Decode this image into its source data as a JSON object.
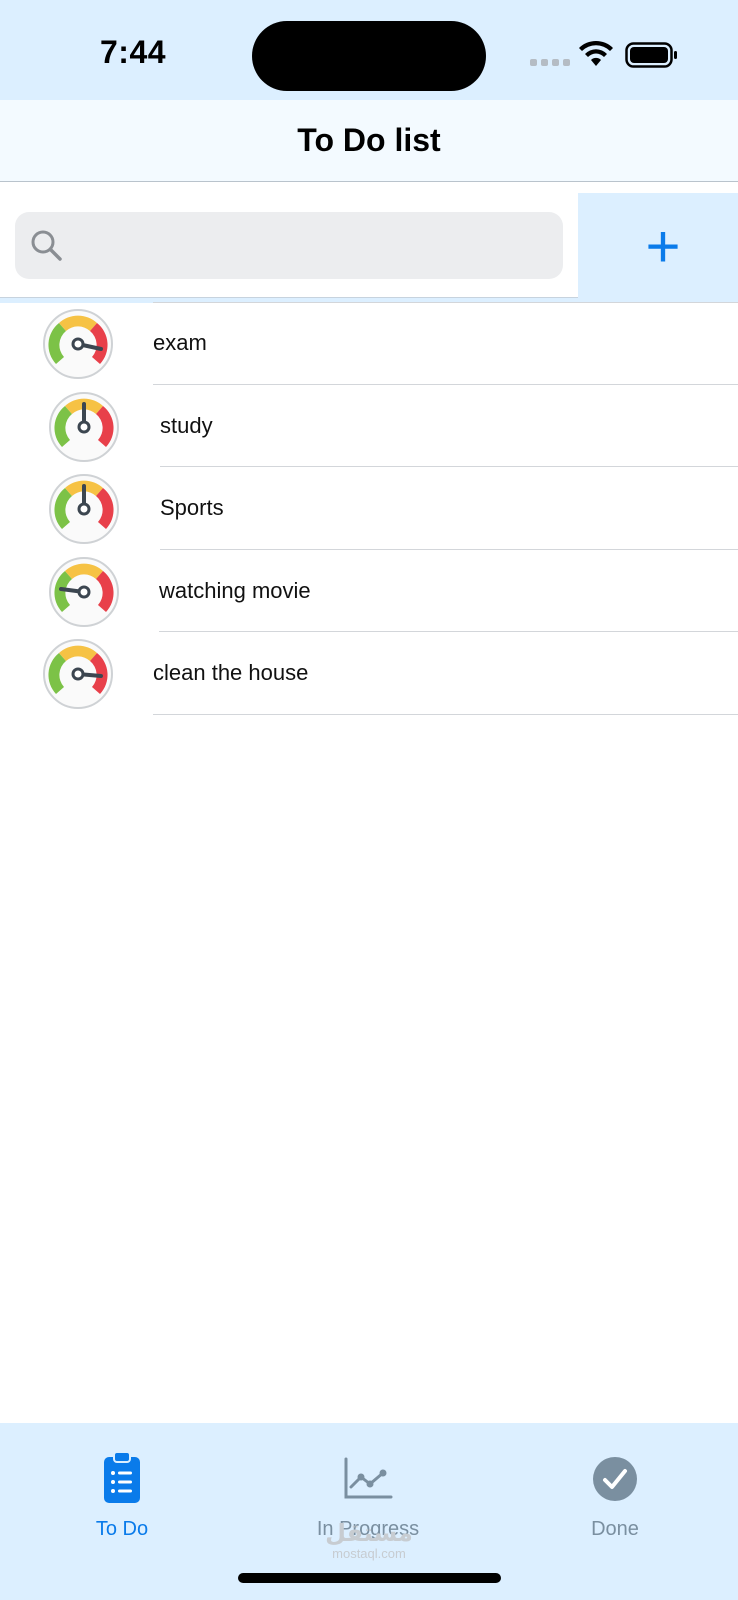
{
  "status": {
    "time": "7:44"
  },
  "nav": {
    "title": "To Do list"
  },
  "search": {
    "placeholder": "",
    "value": "",
    "add_label": "+"
  },
  "tasks": [
    {
      "label": "exam",
      "priority": "high"
    },
    {
      "label": "study",
      "priority": "medium"
    },
    {
      "label": "Sports",
      "priority": "medium"
    },
    {
      "label": "watching movie",
      "priority": "low"
    },
    {
      "label": "clean the house",
      "priority": "high"
    }
  ],
  "tabs": [
    {
      "label": "To Do",
      "icon": "clipboard-list-icon",
      "active": true
    },
    {
      "label": "In Progress",
      "icon": "line-chart-icon",
      "active": false
    },
    {
      "label": "Done",
      "icon": "checkmark-circle-icon",
      "active": false
    }
  ],
  "watermark": {
    "arabic": "مستقل",
    "latin": "mostaql.com"
  },
  "colors": {
    "accent": "#0a7bea",
    "bar_background": "#dcefff",
    "inactive_tab": "#7a8fa0",
    "gauge_green": "#7cc247",
    "gauge_yellow": "#f6c244",
    "gauge_red": "#e8404a"
  }
}
